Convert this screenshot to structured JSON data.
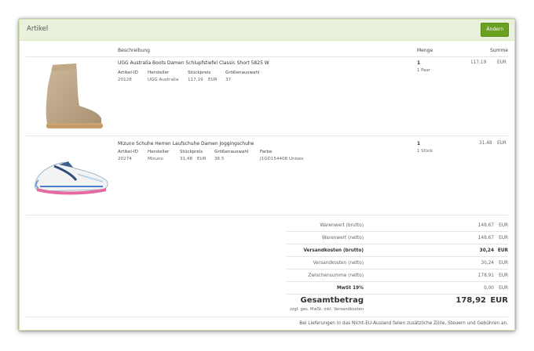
{
  "panel": {
    "title": "Artikel",
    "edit_button": "Ändern"
  },
  "columns": {
    "description": "Beschreibung",
    "quantity": "Menge",
    "sum": "Summe"
  },
  "items": [
    {
      "name": "UGG Australia Boots Damen Schlupfstiefel Classic Short 5825 W",
      "attrs": {
        "labels": [
          "Artikel-ID",
          "Hersteller",
          "Stückpreis",
          "Größenauswahl"
        ],
        "values": [
          "20128",
          "UGG Australia",
          "117,19",
          "EUR",
          "37"
        ]
      },
      "quantity": "1",
      "quantity_unit": "1 Paar",
      "sum": "117,19",
      "currency": "EUR",
      "image_icon": "ugg-boot-image"
    },
    {
      "name": "Mizuno Schuhe Herren Laufschuhe Damen Joggingschuhe",
      "attrs": {
        "labels": [
          "Artikel-ID",
          "Hersteller",
          "Stückpreis",
          "Größenauswahl",
          "Farbe"
        ],
        "values": [
          "20274",
          "Mizuno",
          "31,48",
          "EUR",
          "36.5",
          "J1GD154408 Unisex"
        ]
      },
      "quantity": "1",
      "quantity_unit": "1 Stück",
      "sum": "31,48",
      "currency": "EUR",
      "image_icon": "running-shoe-image"
    }
  ],
  "totals": {
    "goods_gross": {
      "label": "Warenwert (brutto)",
      "value": "148,67",
      "currency": "EUR"
    },
    "goods_net": {
      "label": "Warenwert (netto)",
      "value": "148,67",
      "currency": "EUR"
    },
    "shipping_gross": {
      "label": "Versandkosten (brutto)",
      "value": "30,24",
      "currency": "EUR"
    },
    "shipping_net": {
      "label": "Versandkosten (netto)",
      "value": "30,24",
      "currency": "EUR"
    },
    "subtotal": {
      "label": "Zwischensumme (netto)",
      "value": "178,91",
      "currency": "EUR"
    },
    "vat": {
      "label": "MwSt 19%",
      "value": "0,00",
      "currency": "EUR"
    },
    "grand": {
      "label": "Gesamtbetrag",
      "value": "178,92",
      "currency": "EUR",
      "note": "zzgl. ges. MwSt. inkl. Versandkosten"
    }
  },
  "footer_note": "Bei Lieferungen in das Nicht-EU-Ausland fallen zusätzliche Zölle, Steuern und Gebühren an."
}
